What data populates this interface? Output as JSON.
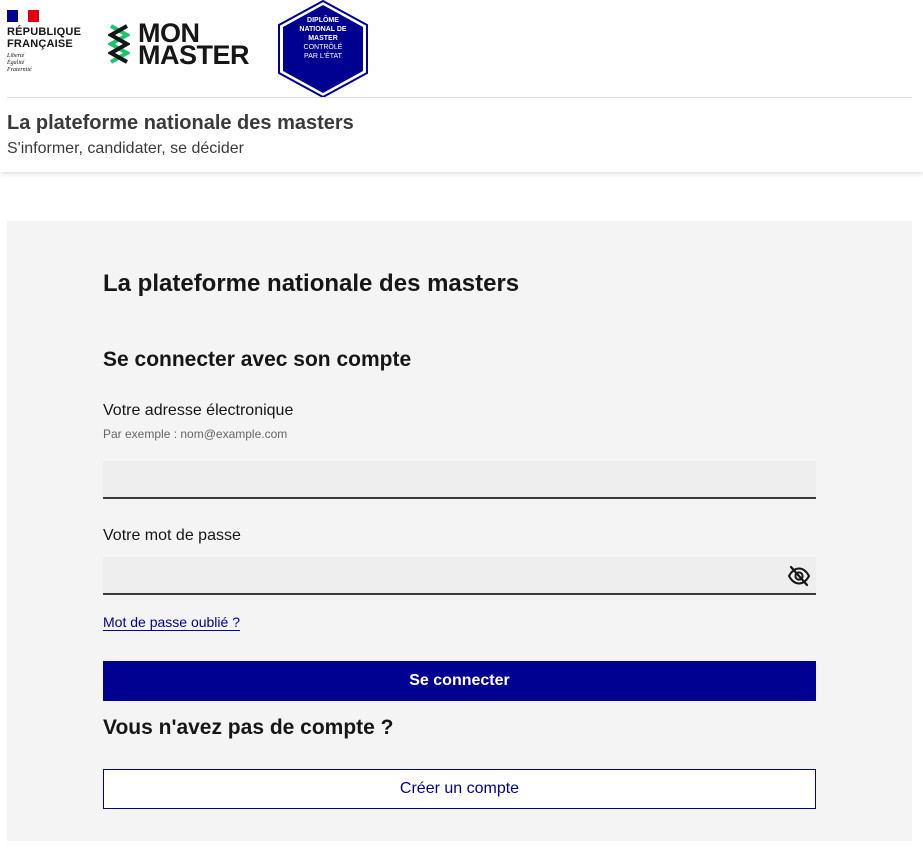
{
  "header": {
    "republique_line1": "RÉPUBLIQUE",
    "republique_line2": "FRANÇAISE",
    "motto_1": "Liberté",
    "motto_2": "Égalité",
    "motto_3": "Fraternité",
    "brand_line1": "MON",
    "brand_line2": "MASTER",
    "badge_line1": "DIPLÔME",
    "badge_line2": "NATIONAL DE",
    "badge_line3": "MASTER",
    "badge_line4": "CONTRÔLÉ",
    "badge_line5": "PAR L'ÉTAT",
    "site_title": "La plateforme nationale des masters",
    "site_tagline": "S'informer, candidater, se décider"
  },
  "login": {
    "title": "La plateforme nationale des masters",
    "subtitle": "Se connecter avec son compte",
    "email_label": "Votre adresse électronique",
    "email_hint": "Par exemple : nom@example.com",
    "email_value": "",
    "password_label": "Votre mot de passe",
    "password_value": "",
    "forgot_link": "Mot de passe oublié ?",
    "submit_label": "Se connecter",
    "no_account_title": "Vous n'avez pas de compte ?",
    "create_account_label": "Créer un compte"
  },
  "icons": {
    "password_toggle": "eye-off-icon"
  },
  "colors": {
    "primary": "#000091",
    "flag_blue": "#000091",
    "flag_red": "#e1000f",
    "brand_green": "#1ec46c",
    "panel_bg": "#f4f4f4",
    "field_bg": "#eeeeee"
  }
}
